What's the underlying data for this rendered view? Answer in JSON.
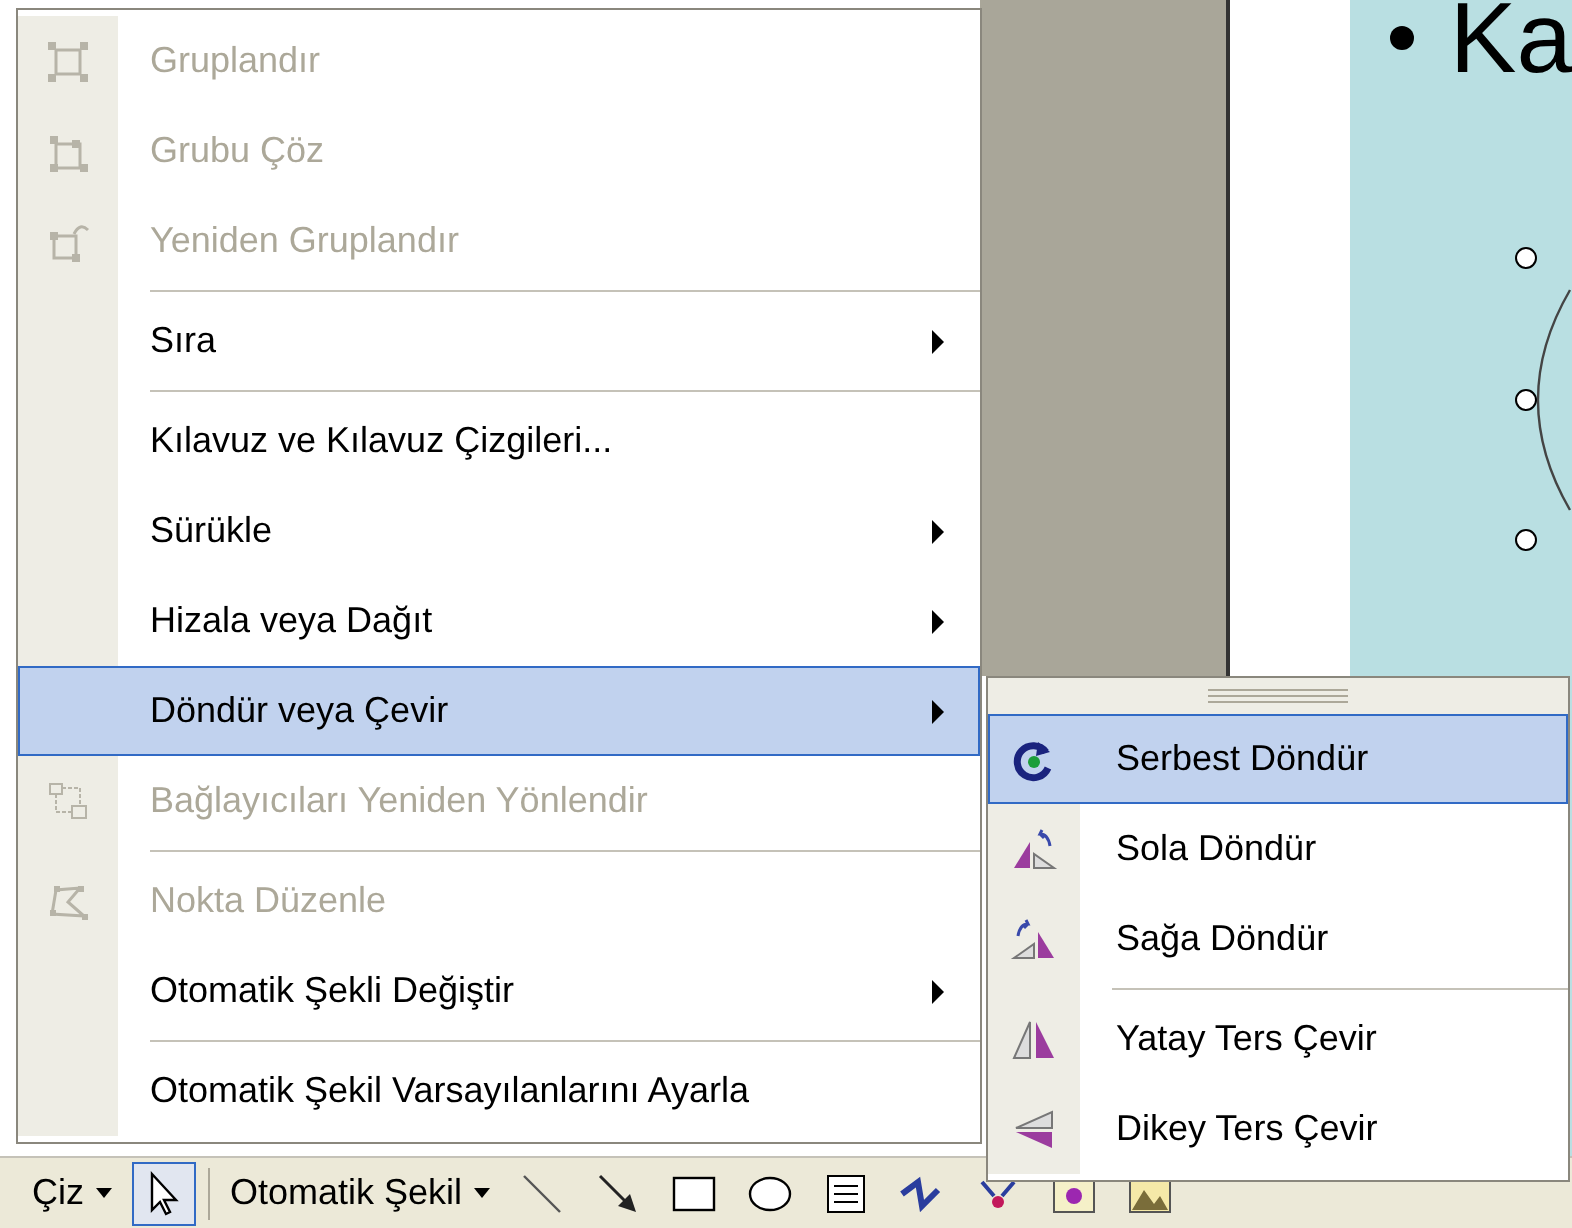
{
  "slide": {
    "bullet_text": "Ka"
  },
  "menu": {
    "items": [
      {
        "kind": "item",
        "label": "Gruplandır",
        "disabled": true,
        "submenu": false,
        "selected": false
      },
      {
        "kind": "item",
        "label": "Grubu Çöz",
        "disabled": true,
        "submenu": false,
        "selected": false
      },
      {
        "kind": "item",
        "label": "Yeniden Gruplandır",
        "disabled": true,
        "submenu": false,
        "selected": false
      },
      {
        "kind": "separator"
      },
      {
        "kind": "item",
        "label": "Sıra",
        "disabled": false,
        "submenu": true,
        "selected": false
      },
      {
        "kind": "separator"
      },
      {
        "kind": "item",
        "label": "Kılavuz ve Kılavuz Çizgileri...",
        "disabled": false,
        "submenu": false,
        "selected": false
      },
      {
        "kind": "item",
        "label": "Sürükle",
        "disabled": false,
        "submenu": true,
        "selected": false
      },
      {
        "kind": "item",
        "label": "Hizala veya Dağıt",
        "disabled": false,
        "submenu": true,
        "selected": false
      },
      {
        "kind": "item",
        "label": "Döndür veya Çevir",
        "disabled": false,
        "submenu": true,
        "selected": true
      },
      {
        "kind": "item",
        "label": "Bağlayıcıları Yeniden Yönlendir",
        "disabled": true,
        "submenu": false,
        "selected": false
      },
      {
        "kind": "separator"
      },
      {
        "kind": "item",
        "label": "Nokta Düzenle",
        "disabled": true,
        "submenu": false,
        "selected": false
      },
      {
        "kind": "item",
        "label": "Otomatik Şekli Değiştir",
        "disabled": false,
        "submenu": true,
        "selected": false
      },
      {
        "kind": "separator"
      },
      {
        "kind": "item",
        "label": "Otomatik Şekil Varsayılanlarını Ayarla",
        "disabled": false,
        "submenu": false,
        "selected": false
      }
    ]
  },
  "submenu": {
    "items": [
      {
        "kind": "item",
        "label": "Serbest Döndür",
        "selected": true
      },
      {
        "kind": "item",
        "label": "Sola Döndür",
        "selected": false
      },
      {
        "kind": "item",
        "label": "Sağa Döndür",
        "selected": false
      },
      {
        "kind": "separator"
      },
      {
        "kind": "item",
        "label": "Yatay Ters Çevir",
        "selected": false
      },
      {
        "kind": "item",
        "label": "Dikey Ters Çevir",
        "selected": false
      }
    ]
  },
  "toolbar": {
    "draw_menu": "Çiz",
    "autoshapes_menu": "Otomatik Şekil",
    "tools": [
      {
        "selected": true
      },
      {
        "selected": false
      },
      {
        "selected": false
      },
      {
        "selected": false
      },
      {
        "selected": false
      },
      {
        "selected": false
      },
      {
        "selected": false
      },
      {
        "selected": false
      },
      {
        "selected": false
      },
      {
        "selected": false
      }
    ]
  }
}
